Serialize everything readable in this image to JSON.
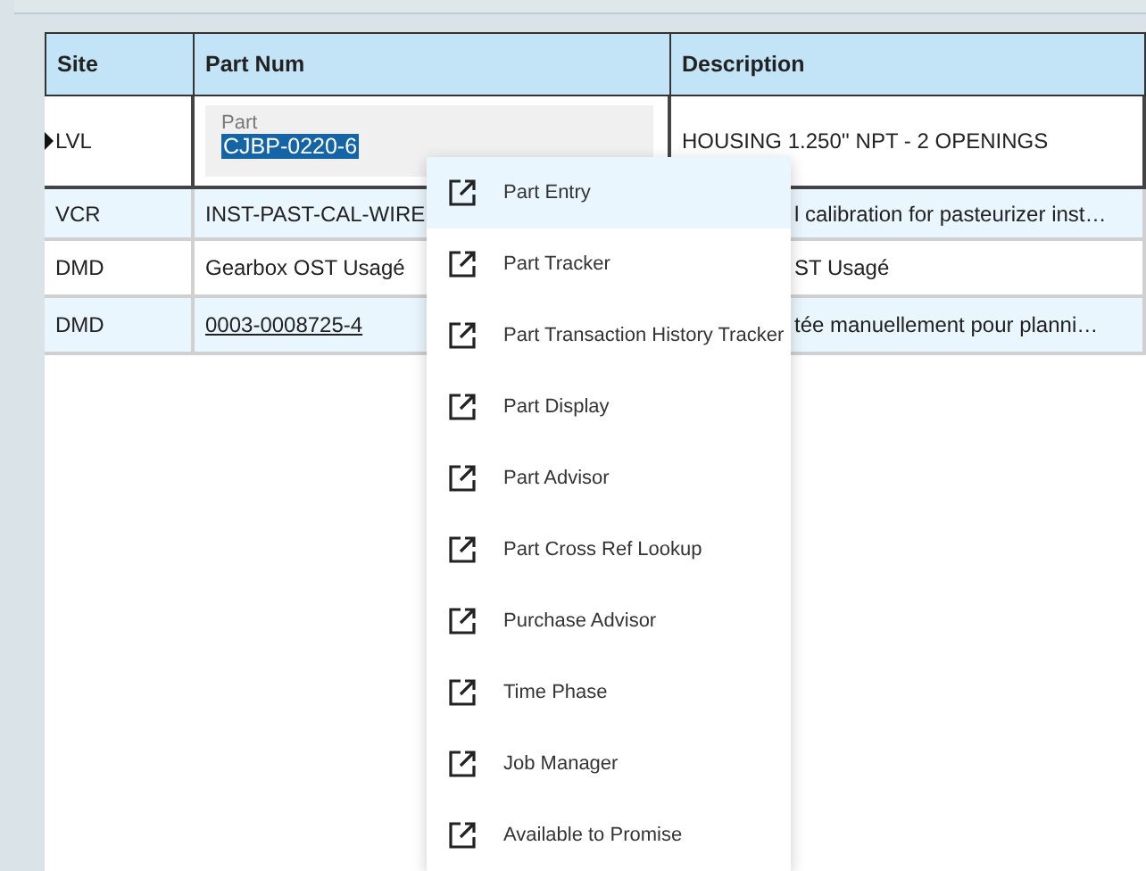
{
  "table": {
    "columns": [
      "Site",
      "Part Num",
      "Description"
    ],
    "rows": [
      {
        "current": true,
        "site": "LVL",
        "part": {
          "kind": "field",
          "label": "Part",
          "value": "CJBP-0220-6"
        },
        "description": "HOUSING 1.250'' NPT - 2 OPENINGS"
      },
      {
        "current": false,
        "site": "VCR",
        "part": {
          "kind": "text",
          "value": "INST-PAST-CAL-WIRE"
        },
        "description": "l calibration for pasteurizer inst…"
      },
      {
        "current": false,
        "site": "DMD",
        "part": {
          "kind": "text",
          "value": "Gearbox OST Usagé"
        },
        "description": "ST Usagé"
      },
      {
        "current": false,
        "site": "DMD",
        "part": {
          "kind": "link",
          "value": "0003-0008725-4"
        },
        "description": "tée manuellement pour planni…"
      }
    ]
  },
  "context_menu": {
    "items": [
      {
        "label": "Part Entry",
        "selected": true
      },
      {
        "label": "Part Tracker",
        "selected": false
      },
      {
        "label": "Part Transaction History Tracker",
        "selected": false
      },
      {
        "label": "Part Display",
        "selected": false
      },
      {
        "label": "Part Advisor",
        "selected": false
      },
      {
        "label": "Part Cross Ref Lookup",
        "selected": false
      },
      {
        "label": "Purchase Advisor",
        "selected": false
      },
      {
        "label": "Time Phase",
        "selected": false
      },
      {
        "label": "Job Manager",
        "selected": false
      },
      {
        "label": "Available to Promise",
        "selected": false
      }
    ]
  }
}
